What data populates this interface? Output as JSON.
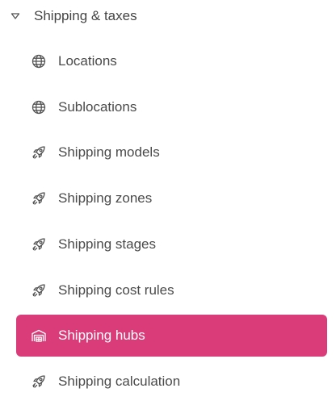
{
  "section": {
    "label": "Shipping & taxes",
    "expanded": true,
    "caret_icon": "caret-down-outline-icon"
  },
  "colors": {
    "active_bg": "#d93c78",
    "active_text": "#ffffff",
    "text": "#4a4a4a",
    "icon": "#555555"
  },
  "items": [
    {
      "label": "Locations",
      "icon": "globe-icon",
      "active": false
    },
    {
      "label": "Sublocations",
      "icon": "globe-icon",
      "active": false
    },
    {
      "label": "Shipping models",
      "icon": "rocket-icon",
      "active": false
    },
    {
      "label": "Shipping zones",
      "icon": "rocket-icon",
      "active": false
    },
    {
      "label": "Shipping stages",
      "icon": "rocket-icon",
      "active": false
    },
    {
      "label": "Shipping cost rules",
      "icon": "rocket-icon",
      "active": false
    },
    {
      "label": "Shipping hubs",
      "icon": "warehouse-icon",
      "active": true
    },
    {
      "label": "Shipping calculation",
      "icon": "rocket-icon",
      "active": false
    }
  ]
}
